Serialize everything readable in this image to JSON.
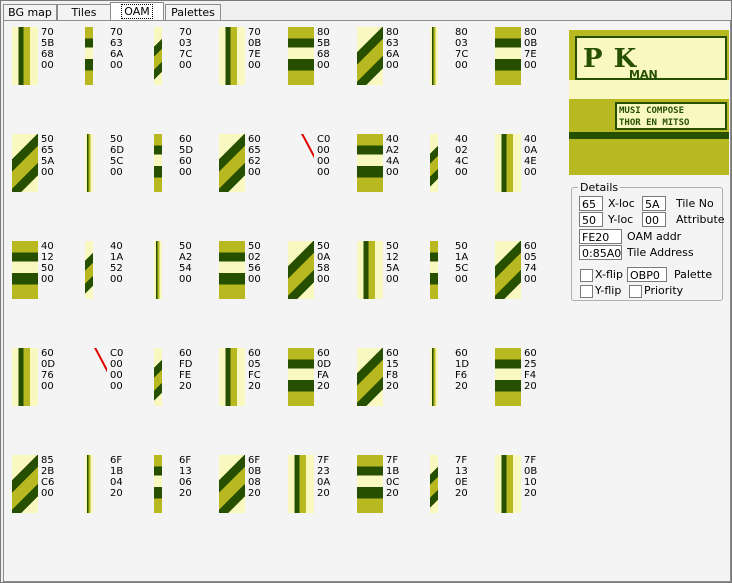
{
  "tabs": [
    {
      "label": "BG map"
    },
    {
      "label": "Tiles"
    },
    {
      "label": "OAM",
      "active": true
    },
    {
      "label": "Palettes"
    }
  ],
  "oam_entries": [
    [
      "70",
      "5B",
      "68",
      "00"
    ],
    [
      "70",
      "63",
      "6A",
      "00"
    ],
    [
      "70",
      "03",
      "7C",
      "00"
    ],
    [
      "70",
      "0B",
      "7E",
      "00"
    ],
    [
      "80",
      "5B",
      "68",
      "00"
    ],
    [
      "80",
      "63",
      "6A",
      "00"
    ],
    [
      "80",
      "03",
      "7C",
      "00"
    ],
    [
      "80",
      "0B",
      "7E",
      "00"
    ],
    [
      "50",
      "65",
      "5A",
      "00"
    ],
    [
      "50",
      "6D",
      "5C",
      "00"
    ],
    [
      "60",
      "5D",
      "60",
      "00"
    ],
    [
      "60",
      "65",
      "62",
      "00"
    ],
    [
      "C0",
      "00",
      "00",
      "00"
    ],
    [
      "40",
      "A2",
      "4A",
      "00"
    ],
    [
      "40",
      "02",
      "4C",
      "00"
    ],
    [
      "40",
      "0A",
      "4E",
      "00"
    ],
    [
      "40",
      "12",
      "50",
      "00"
    ],
    [
      "40",
      "1A",
      "52",
      "00"
    ],
    [
      "50",
      "A2",
      "54",
      "00"
    ],
    [
      "50",
      "02",
      "56",
      "00"
    ],
    [
      "50",
      "0A",
      "58",
      "00"
    ],
    [
      "50",
      "12",
      "5A",
      "00"
    ],
    [
      "50",
      "1A",
      "5C",
      "00"
    ],
    [
      "60",
      "05",
      "74",
      "00"
    ],
    [
      "60",
      "0D",
      "76",
      "00"
    ],
    [
      "C0",
      "00",
      "00",
      "00"
    ],
    [
      "60",
      "FD",
      "FE",
      "20"
    ],
    [
      "60",
      "05",
      "FC",
      "20"
    ],
    [
      "60",
      "0D",
      "FA",
      "20"
    ],
    [
      "60",
      "15",
      "F8",
      "20"
    ],
    [
      "60",
      "1D",
      "F6",
      "20"
    ],
    [
      "60",
      "25",
      "F4",
      "20"
    ],
    [
      "85",
      "2B",
      "C6",
      "00"
    ],
    [
      "6F",
      "1B",
      "04",
      "20"
    ],
    [
      "6F",
      "13",
      "06",
      "20"
    ],
    [
      "6F",
      "0B",
      "08",
      "20"
    ],
    [
      "7F",
      "23",
      "0A",
      "20"
    ],
    [
      "7F",
      "1B",
      "0C",
      "20"
    ],
    [
      "7F",
      "13",
      "0E",
      "20"
    ],
    [
      "7F",
      "0B",
      "10",
      "20"
    ]
  ],
  "preview": {
    "logo_text": "P  K",
    "logo_sub": "MAN",
    "banner_line1": "MUSI  COMPOSE",
    "banner_line2": "THOR  EN MITSO"
  },
  "details": {
    "legend": "Details",
    "x_loc_value": "65",
    "x_loc_label": "X-loc",
    "y_loc_value": "50",
    "y_loc_label": "Y-loc",
    "tile_no_value": "5A",
    "tile_no_label": "Tile No",
    "attribute_value": "00",
    "attribute_label": "Attribute",
    "oam_addr_value": "FE20",
    "oam_addr_label": "OAM addr",
    "tile_address_value": "0:85A0",
    "tile_address_label": "Tile Address",
    "xflip_label": "X-flip",
    "yflip_label": "Y-flip",
    "palette_value": "OBP0",
    "palette_label": "Palette",
    "priority_label": "Priority"
  },
  "colors": {
    "gb_dark": "#264f00",
    "gb_mid": "#b8b820",
    "gb_light": "#f8f8c0",
    "hidden_marker": "#e00000"
  }
}
